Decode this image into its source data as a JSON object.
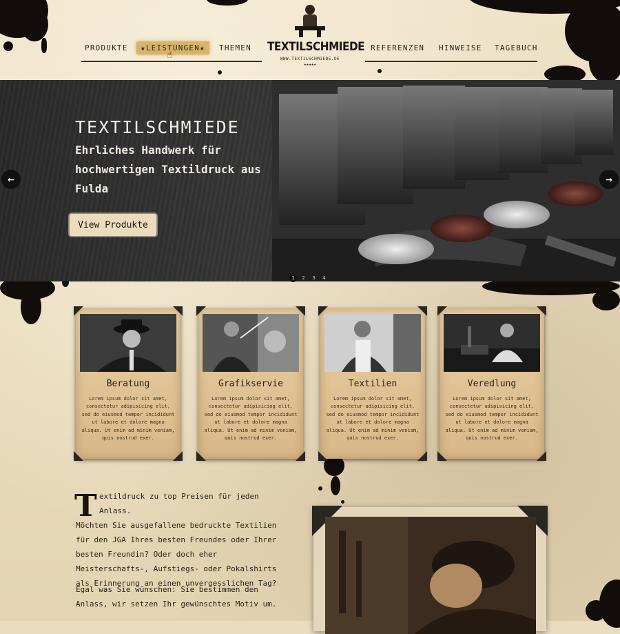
{
  "brand": {
    "name": "TEXTILSCHMIEDE",
    "url": "WWW.TEXTILSCHMIEDE.DE",
    "stars": "★★★★★"
  },
  "nav": {
    "items": [
      "PRODUKTE",
      "★LEISTUNGEN★",
      "THEMEN",
      "REFERENZEN",
      "HINWEISE",
      "TAGEBUCH"
    ],
    "active": "★LEISTUNGEN★"
  },
  "hero": {
    "title": "TEXTILSCHMIEDE",
    "subtitle": "Ehrliches Handwerk für hochwertigen Textildruck aus Fulda",
    "button": "View Produkte",
    "prev_icon": "arrow-left-icon",
    "next_icon": "arrow-right-icon",
    "slides": [
      "1",
      "2",
      "3",
      "4"
    ],
    "active_slide": "1"
  },
  "cards": [
    {
      "title": "Beratung",
      "text": "Lorem ipsum dolor sit amet, consectetur adipisicing elit, sed do eiusmod tempor incididunt ut labore et dolore magna aliqua. Ut enim ad minim veniam, quis nostrud exer."
    },
    {
      "title": "Grafikservie",
      "text": "Lorem ipsum dolor sit amet, consectetur adipisicing elit, sed do eiusmod tempor incididunt ut labore et dolore magna aliqua. Ut enim ad minim veniam, quis nostrud exer."
    },
    {
      "title": "Textilien",
      "text": "Lorem ipsum dolor sit amet, consectetur adipisicing elit, sed do eiusmod tempor incididunt ut labore et dolore magna aliqua. Ut enim ad minim veniam, quis nostrud exer."
    },
    {
      "title": "Veredlung",
      "text": "Lorem ipsum dolor sit amet, consectetur adipisicing elit, sed do eiusmod tempor incididunt ut labore et dolore magna aliqua. Ut enim ad minim veniam, quis nostrud exer."
    }
  ],
  "intro": {
    "dropcap": "T",
    "first_line": "extildruck zu top Preisen für jeden Anlass.",
    "rest": "Möchten Sie ausgefallene bedruckte Textilien für den JGA Ihres besten Freundes oder Ihrer besten Freundin? Oder doch eher Meisterschafts-, Aufstiegs- oder Pokalshirts als Erinnerung an einen unvergesslichen Tag?",
    "para2": "Egal was Sie wünschen: Sie bestimmen den Anlass, wir setzen Ihr gewünschtes Motiv um."
  },
  "colors": {
    "paper": "#e9dcbf",
    "ink": "#120d0a",
    "accent": "#d8b46a",
    "button": "#ecdcbd"
  }
}
